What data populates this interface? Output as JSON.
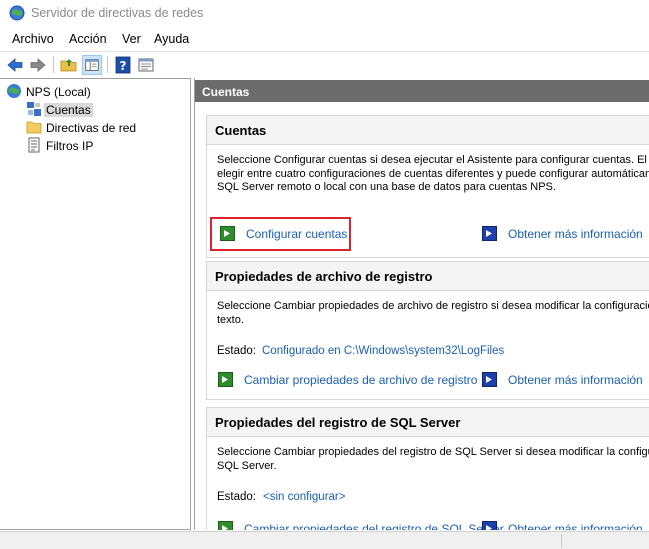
{
  "window": {
    "title": "Servidor de directivas de redes"
  },
  "menu": [
    "Archivo",
    "Acción",
    "Ver",
    "Ayuda"
  ],
  "toolbar": {
    "icons": [
      "back-arrow-icon",
      "forward-arrow-icon",
      "folder-up-icon",
      "show-tree-icon",
      "help-icon",
      "properties-icon"
    ]
  },
  "tree": {
    "root": "NPS (Local)",
    "items": [
      {
        "label": "Cuentas",
        "icon": "accounting-icon",
        "selected": true
      },
      {
        "label": "Directivas de red",
        "icon": "folder-icon"
      },
      {
        "label": "Filtros IP",
        "icon": "filter-icon"
      }
    ]
  },
  "main": {
    "header": "Cuentas",
    "sections": [
      {
        "title": "Cuentas",
        "desc": [
          "Seleccione Configurar cuentas si desea ejecutar el Asistente para configurar cuentas. El asis",
          "elegir entre cuatro configuraciones de cuentas diferentes y puede configurar automáticamen",
          "SQL Server remoto o local con una base de datos para cuentas NPS."
        ],
        "action": "Configurar cuentas",
        "more": "Obtener más información"
      },
      {
        "title": "Propiedades de archivo de registro",
        "desc": [
          "Seleccione Cambiar propiedades de archivo de registro si desea modificar la configuración d",
          "texto."
        ],
        "status_label": "Estado:",
        "status_value": "Configurado en C:\\Windows\\system32\\LogFiles",
        "action": "Cambiar propiedades de archivo de registro",
        "more": "Obtener más información"
      },
      {
        "title": "Propiedades del registro de SQL Server",
        "desc": [
          "Seleccione Cambiar propiedades del registro de SQL Server si desea modificar la configuraci",
          "SQL Server."
        ],
        "status_label": "Estado:",
        "status_value": "<sin configurar>",
        "action": "Cambiar propiedades del registro de SQL Server",
        "more": "Obtener más información"
      }
    ]
  },
  "colors": {
    "link": "#1a5fb4",
    "header_bg": "#6c6c6c",
    "highlight": "#d9232d",
    "go_icon": "#2e8b2e",
    "info_icon": "#1c3fa8"
  }
}
